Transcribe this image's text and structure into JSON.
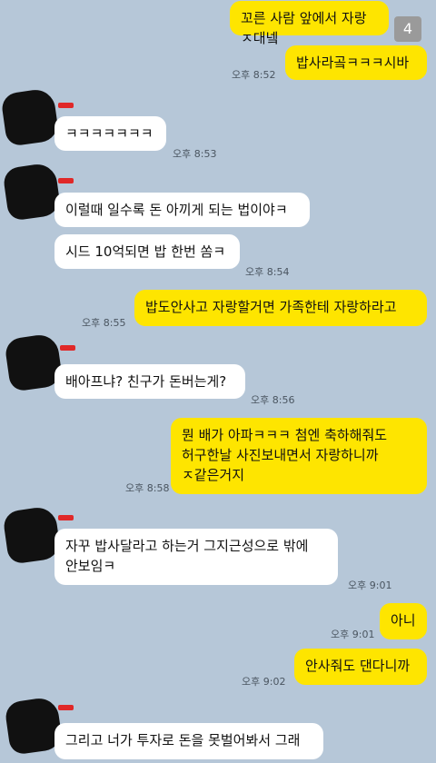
{
  "photo_count": "4",
  "messages": [
    {
      "text": "꼬른 사람 앞에서 자랑 ㅈ대넼"
    },
    {
      "text": "밥사라곸ㅋㅋㅋ시바",
      "time": "오후 8:52"
    },
    {
      "text": "ㅋㅋㅋㅋㅋㅋㅋ",
      "time": "오후 8:53"
    },
    {
      "text": "이럴때 일수록 돈 아끼게 되는 법이야ㅋ"
    },
    {
      "text": "시드 10억되면 밥 한번 쏨ㅋ",
      "time": "오후 8:54"
    },
    {
      "text": "밥도안사고 자랑할거면 가족한테 자랑하라고",
      "time": "오후 8:55"
    },
    {
      "text": "배아프냐? 친구가 돈버는게?",
      "time": "오후 8:56"
    },
    {
      "text": "뭔 배가 아파ㅋㅋㅋ 첨엔 축하해줘도\n허구한날 사진보내면서 자랑하니까\nㅈ같은거지",
      "time": "오후 8:58"
    },
    {
      "text": "자꾸 밥사달라고 하는거 그지근성으로 밖에\n안보임ㅋ",
      "time": "오후 9:01"
    },
    {
      "text": "아니",
      "time": "오후 9:01"
    },
    {
      "text": "안사줘도 댄다니까",
      "time": "오후 9:02"
    },
    {
      "text": "그리고 너가 투자로 돈을 못벌어봐서 그래"
    }
  ]
}
